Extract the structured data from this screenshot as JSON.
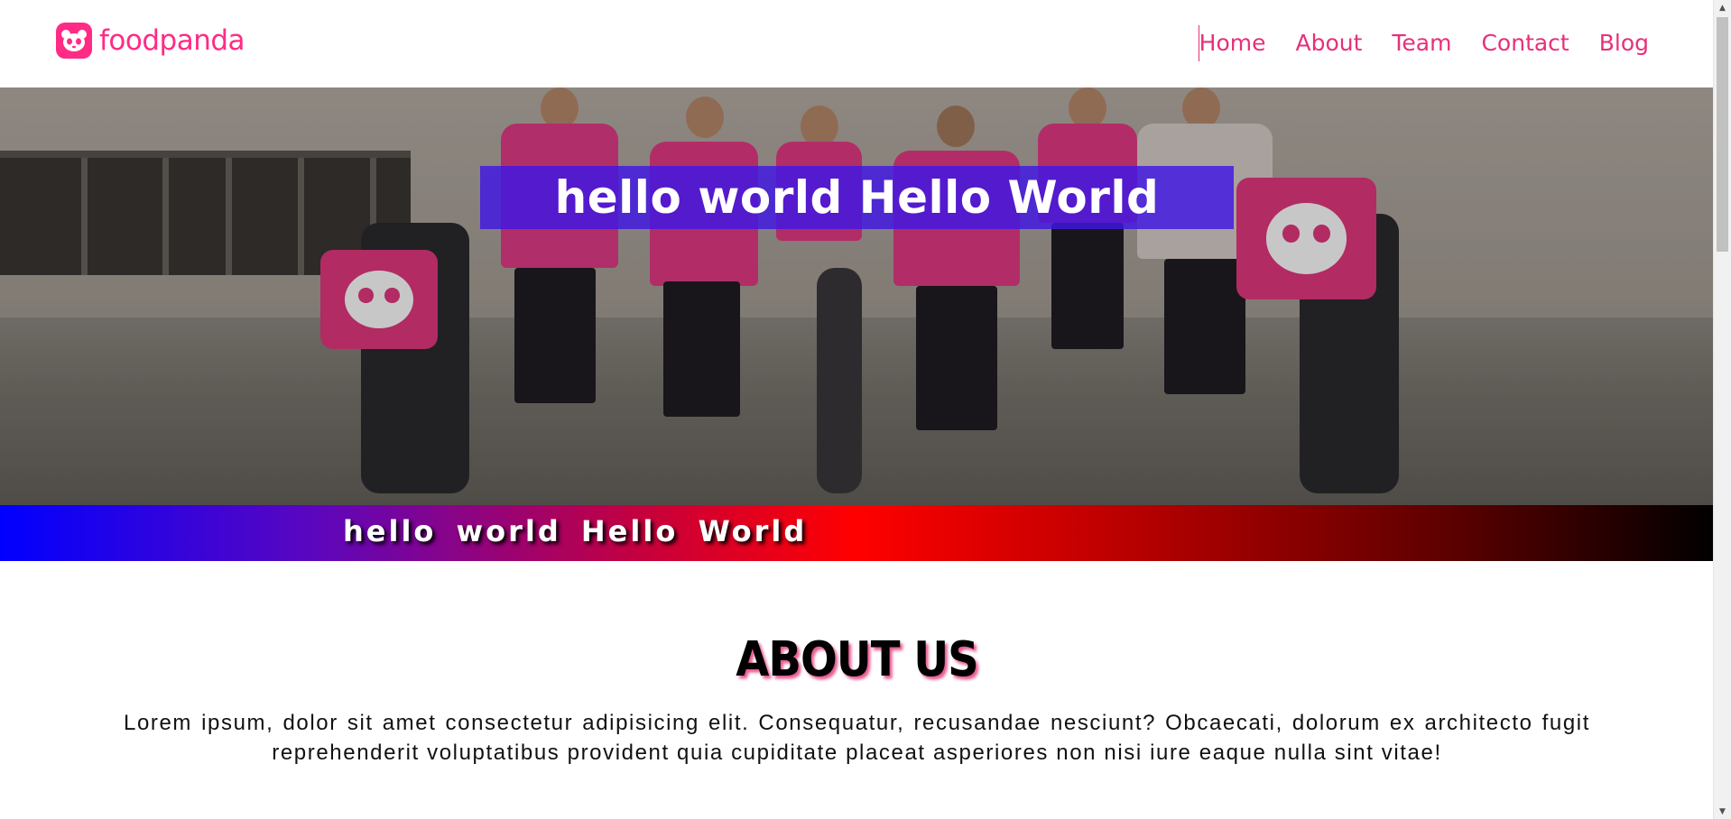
{
  "brand": {
    "name": "foodpanda",
    "color": "#ff2b85"
  },
  "nav": {
    "items": [
      {
        "label": "Home"
      },
      {
        "label": "About"
      },
      {
        "label": "Team"
      },
      {
        "label": "Contact"
      },
      {
        "label": "Blog"
      }
    ]
  },
  "hero": {
    "title": "hello world Hello World",
    "title_box_color": "#3f16e4"
  },
  "band": {
    "text": "hello world Hello World",
    "gradient": [
      "#0000ff",
      "#ff0000",
      "#000000"
    ]
  },
  "about": {
    "heading": "ABOUT US",
    "body": "Lorem ipsum, dolor sit amet consectetur adipisicing elit. Consequatur, recusandae nesciunt? Obcaecati, dolorum ex architecto fugit reprehenderit voluptatibus provident quia cupiditate placeat asperiores non nisi iure eaque nulla sint vitae!"
  },
  "icons": {
    "logo": "panda-logo-icon",
    "scroll_up": "chevron-up-icon",
    "scroll_down": "chevron-down-icon"
  }
}
